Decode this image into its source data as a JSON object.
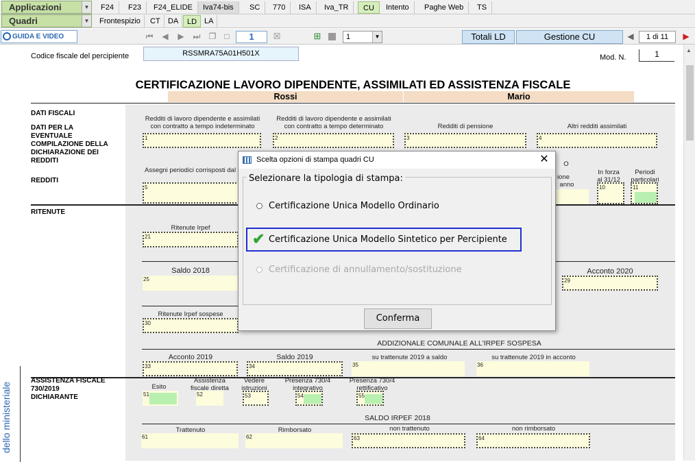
{
  "topbar": {
    "applicazioni": "Applicazioni",
    "tabs": [
      "F24",
      "F23",
      "F24_ELIDE",
      "Iva74-bis",
      "SC",
      "770",
      "ISA",
      "Iva_TR",
      "CU",
      "Intento",
      "Paghe Web",
      "TS"
    ]
  },
  "quadribar": {
    "quadri": "Quadri",
    "tabs": [
      "Frontespizio",
      "CT",
      "DA",
      "LD",
      "LA"
    ]
  },
  "toolbar": {
    "guida": "GUIDA E VIDEO",
    "page_num": "1",
    "select_value": "1",
    "totali": "Totali LD",
    "gestione": "Gestione CU",
    "page_of": "1 di 11"
  },
  "form": {
    "cf_label": "Codice fiscale del percipiente",
    "cf_value": "RSSMRA75A01H501X",
    "mod_label": "Mod. N.",
    "mod_value": "1",
    "title": "CERTIFICAZIONE LAVORO DIPENDENTE, ASSIMILATI ED ASSISTENZA FISCALE",
    "surname": "Rossi",
    "name": "Mario",
    "dati_fiscali": "DATI FISCALI",
    "dati_eventuale": "DATI PER LA EVENTUALE COMPILAZIONE DELLA DICHIARAZIONE DEI REDDITI",
    "redditi": "REDDITI",
    "ritenute": "RITENUTE",
    "cap1": "Redditi di lavoro dipendente e assimilati con contratto a tempo indeterminato",
    "cap2": "Redditi di lavoro dipendente e assimilati con contratto a tempo determinato",
    "cap3": "Redditi di pensione",
    "cap4": "Altri redditi assimilati",
    "cap5": "Assegni periodici corrisposti dal coniuge",
    "cap_ione": "ione",
    "cap_anno": "anno",
    "cap10": "In forza al 31/12",
    "cap11": "Periodi particolari",
    "cap_o": "O",
    "cap21": "Ritenute Irpef",
    "cap25": "Saldo 2018",
    "cap29": "Acconto 2020",
    "cap30": "Ritenute Irpef sospese",
    "addiz_sospesa": "ADDIZIONALE COMUNALE ALL'IRPEF SOSPESA",
    "cap33": "Acconto 2019",
    "cap34": "Saldo 2019",
    "cap35": "su trattenute 2019 a saldo",
    "cap36": "su trattenute 2019 in acconto",
    "assistenza": "ASSISTENZA FISCALE 730/2019 DICHIARANTE",
    "cap51": "Esito",
    "cap52": "Assistenza fiscale diretta",
    "cap53": "Vedere istruzioni",
    "cap54": "Presenza 730/4 integrativo",
    "cap55": "Presenza 730/4 rettificativo",
    "saldo_irpef": "SALDO IRPEF 2018",
    "cap61": "Trattenuto",
    "cap62": "Rimborsato",
    "cap63": "non trattenuto",
    "cap64": "non rimborsato",
    "vertical": "dello ministeriale"
  },
  "dialog": {
    "title": "Scelta opzioni di stampa quadri CU",
    "group_label": "Selezionare la tipologia di stampa:",
    "option1": "Certificazione Unica Modello Ordinario",
    "option2": "Certificazione Unica Modello Sintetico per Percipiente",
    "option3": "Certificazione di annullamento/sostituzione",
    "confirm": "Conferma"
  },
  "colors": {
    "field_bg": "#fdfcdc",
    "field_green": "#b8f0b0",
    "highlight_border": "#1f2fcf",
    "check_green": "#2fa52f"
  }
}
